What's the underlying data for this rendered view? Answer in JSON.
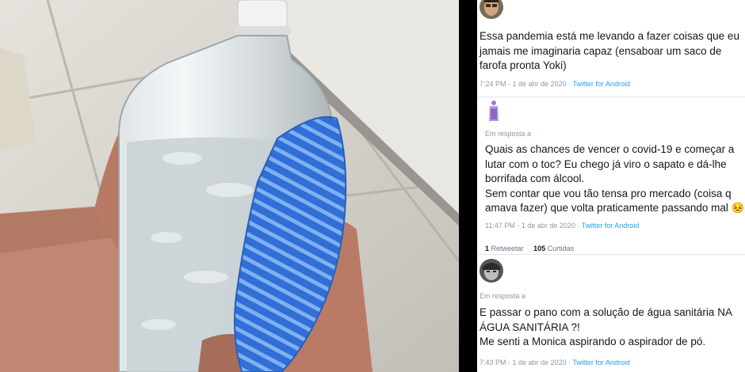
{
  "tweets": [
    {
      "reply_label": "",
      "text": "Essa pandemia está me levando a fazer coisas que eu\njamais me imaginaria capaz (ensaboar um saco de\nfarofa pronta Yoki)",
      "timestamp": "7:24 PM - 1 de abr de 2020",
      "separator": " · ",
      "client": "Twitter for Android"
    },
    {
      "reply_label": "Em resposta a",
      "text": "Quais as chances de vencer o covid-19 e começar a\nlutar com o toc? Eu chego já viro o sapato e dá-lhe\nborrifada com álcool.\nSem contar que vou tão tensa pro mercado (coisa q\namava fazer) que volta praticamente passando mal",
      "emoji": "😣",
      "timestamp": "11:47 PM - 1 de abr de 2020",
      "separator": " · ",
      "client": "Twitter for Android",
      "retweets_count": "1",
      "retweets_label": "Retweetar",
      "likes_count": "105",
      "likes_label": "Curtidas"
    },
    {
      "reply_label": "Em resposta a",
      "text": "E passar o pano com a solução de água sanitária NA\nÁGUA SANITÁRIA ?!\nMe senti a Monica aspirando o aspirador de pó.",
      "timestamp": "7:43 PM - 1 de abr de 2020",
      "separator": " · ",
      "client": "Twitter for Android"
    }
  ],
  "colors": {
    "link": "#1da1f2",
    "muted": "#8899a6",
    "text": "#14171a",
    "cloth": "#3a7be0"
  },
  "icons": [
    "avatar-man-face",
    "avatar-purple-figure",
    "avatar-grayscale-face"
  ]
}
